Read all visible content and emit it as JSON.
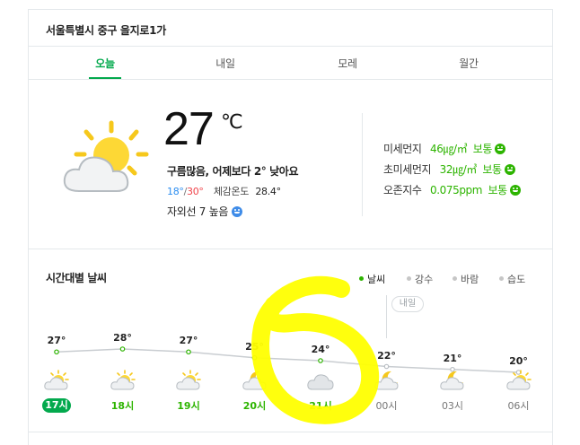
{
  "location": "서울특별시 중구 을지로1가",
  "tabs": [
    {
      "label": "오늘",
      "active": true
    },
    {
      "label": "내일",
      "active": false
    },
    {
      "label": "모레",
      "active": false
    },
    {
      "label": "월간",
      "active": false
    }
  ],
  "current": {
    "icon": "sun-cloud-icon",
    "temperature": "27",
    "unit": "℃",
    "summary": "구름많음, 어제보다 2° 낮아요",
    "min": "18°",
    "max": "30°",
    "feels_label": "체감온도",
    "feels_value": "28.4°",
    "uv": "자외선 7 높음"
  },
  "air": [
    {
      "label": "미세먼지",
      "value": "46㎍/㎥",
      "grade": "보통"
    },
    {
      "label": "초미세먼지",
      "value": "32㎍/㎥",
      "grade": "보통"
    },
    {
      "label": "오존지수",
      "value": "0.075ppm",
      "grade": "보통"
    }
  ],
  "hourly": {
    "title": "시간대별 날씨",
    "legend": [
      {
        "label": "날씨",
        "active": true
      },
      {
        "label": "강수",
        "active": false
      },
      {
        "label": "바람",
        "active": false
      },
      {
        "label": "습도",
        "active": false
      }
    ],
    "tomorrow_tag": "내일",
    "slots": [
      {
        "time": "17시",
        "temp": "27°",
        "icon": "sun-cloud-icon",
        "now": true
      },
      {
        "time": "18시",
        "temp": "28°",
        "icon": "sun-cloud-icon"
      },
      {
        "time": "19시",
        "temp": "27°",
        "icon": "sun-cloud-icon"
      },
      {
        "time": "20시",
        "temp": "25°",
        "icon": "moon-cloud-icon"
      },
      {
        "time": "21시",
        "temp": "24°",
        "icon": "cloud-icon"
      },
      {
        "time": "00시",
        "temp": "22°",
        "icon": "moon-cloud-icon",
        "next_day": true
      },
      {
        "time": "03시",
        "temp": "21°",
        "icon": "moon-cloud-icon",
        "next_day": true
      },
      {
        "time": "06시",
        "temp": "20°",
        "icon": "sun-cloud-icon",
        "next_day": true
      }
    ],
    "values": [
      27,
      28,
      27,
      25,
      24,
      22,
      21,
      20
    ]
  },
  "colors": {
    "accent": "#03a94d",
    "min_temp": "#2b8df0",
    "max_temp": "#f0434a",
    "good_grade": "#2db400",
    "annotation": "#ffff00"
  }
}
